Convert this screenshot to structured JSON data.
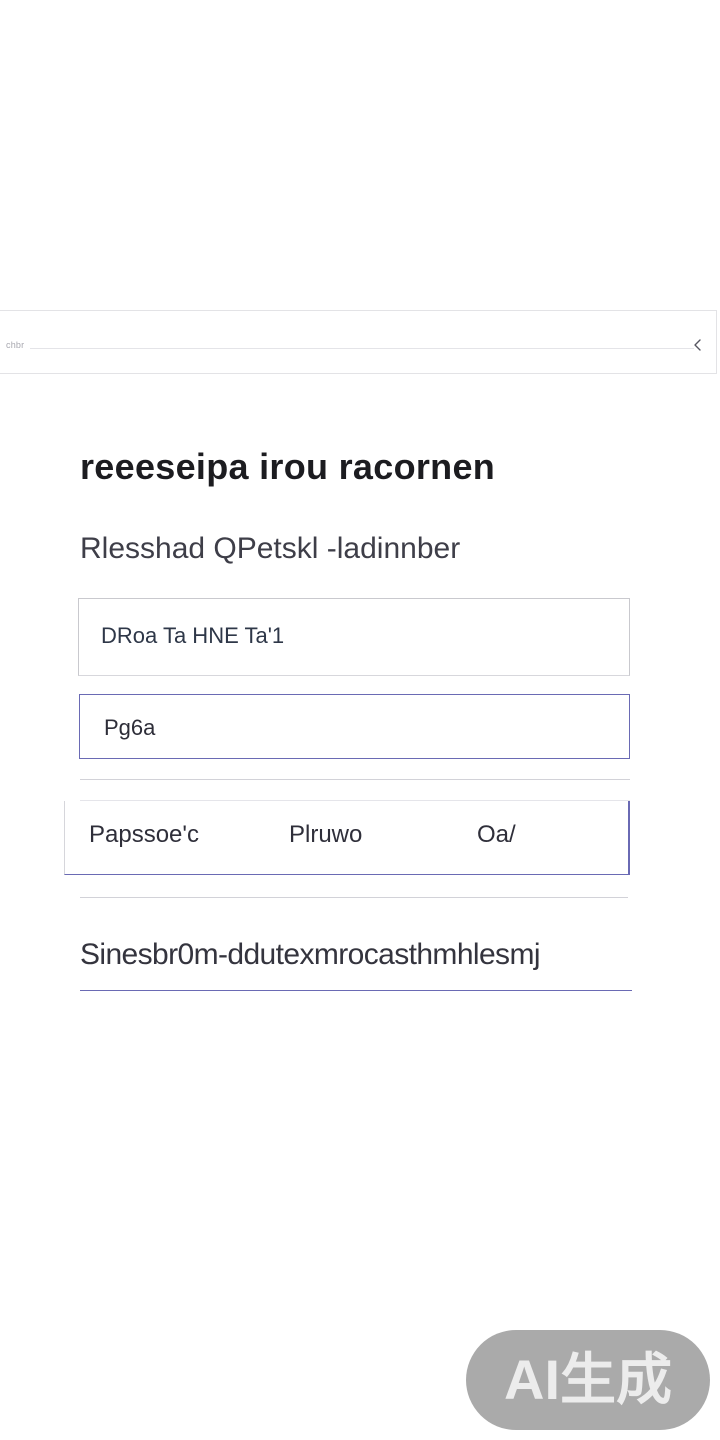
{
  "nav": {
    "hint": "chbr",
    "back_icon": "chevron-left-icon"
  },
  "header": {
    "title": "reeeseipa irou racornen",
    "subtitle": "Rlesshad QPetskl -ladinnber"
  },
  "form": {
    "name_value": "DRoa Ta HNE Ta'1",
    "password_value": "Pg6a",
    "options": [
      {
        "label": "Papssoe'c"
      },
      {
        "label": "Plruwo"
      },
      {
        "label": "Oa/"
      }
    ],
    "footnote": "Sinesbr0m-ddutexmrocasthmhlesmj"
  },
  "watermark": {
    "text": "AI生成"
  },
  "colors": {
    "accent": "#6a6ab4",
    "border": "#c9c9ce",
    "text": "#1f1f24"
  }
}
